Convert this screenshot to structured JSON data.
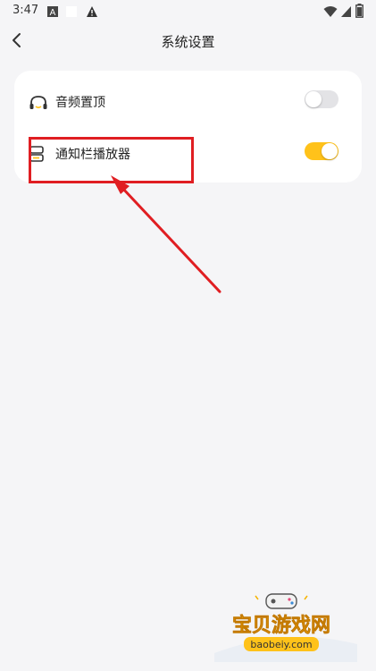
{
  "status": {
    "time": "3:47"
  },
  "header": {
    "title": "系统设置"
  },
  "settings": [
    {
      "label": "音频置顶",
      "enabled": false
    },
    {
      "label": "通知栏播放器",
      "enabled": true
    }
  ],
  "colors": {
    "toggle_on": "#ffc21a",
    "toggle_off": "#e3e3e6",
    "annotation": "#e01e22"
  },
  "watermark": {
    "title": "宝贝游戏网",
    "url": "baobeiy.com"
  }
}
